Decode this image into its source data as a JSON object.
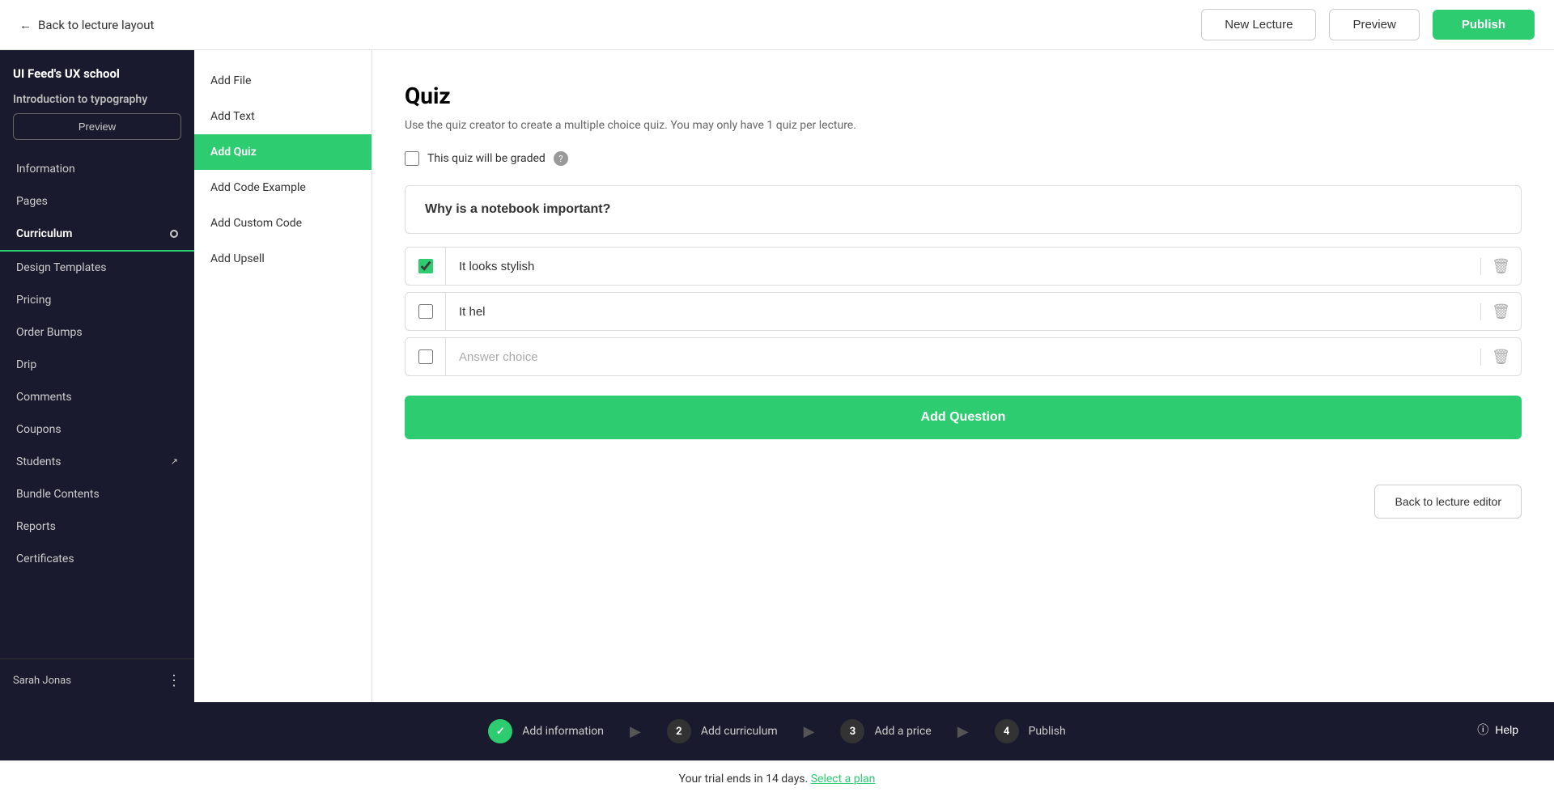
{
  "topbar": {
    "back_label": "Back to lecture layout",
    "new_lecture_label": "New Lecture",
    "preview_label": "Preview",
    "publish_label": "Publish"
  },
  "sidebar": {
    "app_title": "UI Feed's UX school",
    "course_title": "Introduction to typography",
    "preview_btn": "Preview",
    "nav_items": [
      {
        "id": "information",
        "label": "Information",
        "active": false
      },
      {
        "id": "pages",
        "label": "Pages",
        "active": false
      },
      {
        "id": "curriculum",
        "label": "Curriculum",
        "active": true,
        "badge": true
      },
      {
        "id": "design-templates",
        "label": "Design Templates",
        "active": false
      },
      {
        "id": "pricing",
        "label": "Pricing",
        "active": false
      },
      {
        "id": "order-bumps",
        "label": "Order Bumps",
        "active": false
      },
      {
        "id": "drip",
        "label": "Drip",
        "active": false
      },
      {
        "id": "comments",
        "label": "Comments",
        "active": false
      },
      {
        "id": "coupons",
        "label": "Coupons",
        "active": false
      },
      {
        "id": "students",
        "label": "Students",
        "active": false,
        "external": true
      },
      {
        "id": "bundle-contents",
        "label": "Bundle Contents",
        "active": false
      },
      {
        "id": "reports",
        "label": "Reports",
        "active": false
      },
      {
        "id": "certificates",
        "label": "Certificates",
        "active": false
      }
    ],
    "user_name": "Sarah Jonas"
  },
  "content_sidebar": {
    "items": [
      {
        "id": "add-file",
        "label": "Add File",
        "active": false
      },
      {
        "id": "add-text",
        "label": "Add Text",
        "active": false
      },
      {
        "id": "add-quiz",
        "label": "Add Quiz",
        "active": true
      },
      {
        "id": "add-code-example",
        "label": "Add Code Example",
        "active": false
      },
      {
        "id": "add-custom-code",
        "label": "Add Custom Code",
        "active": false
      },
      {
        "id": "add-upsell",
        "label": "Add Upsell",
        "active": false
      }
    ]
  },
  "quiz": {
    "title": "Quiz",
    "subtitle": "Use the quiz creator to create a multiple choice quiz. You may only have 1 quiz per lecture.",
    "graded_label": "This quiz will be graded",
    "question": "Why is a notebook important?",
    "answers": [
      {
        "id": "a1",
        "text": "It looks stylish",
        "checked": true
      },
      {
        "id": "a2",
        "text": "It hel",
        "checked": false
      },
      {
        "id": "a3",
        "text": "",
        "placeholder": "Answer choice",
        "checked": false
      }
    ],
    "add_question_btn": "Add Question",
    "back_to_editor_btn": "Back to lecture editor"
  },
  "progress_steps": [
    {
      "id": "step1",
      "num": "✓",
      "label": "Add information",
      "done": true
    },
    {
      "id": "step2",
      "num": "2",
      "label": "Add curriculum",
      "done": false
    },
    {
      "id": "step3",
      "num": "3",
      "label": "Add a price",
      "done": false
    },
    {
      "id": "step4",
      "num": "4",
      "label": "Publish",
      "done": false
    }
  ],
  "trial_banner": {
    "text": "Your trial ends in 14 days.",
    "link_text": "Select a plan"
  },
  "help_btn": "Help"
}
